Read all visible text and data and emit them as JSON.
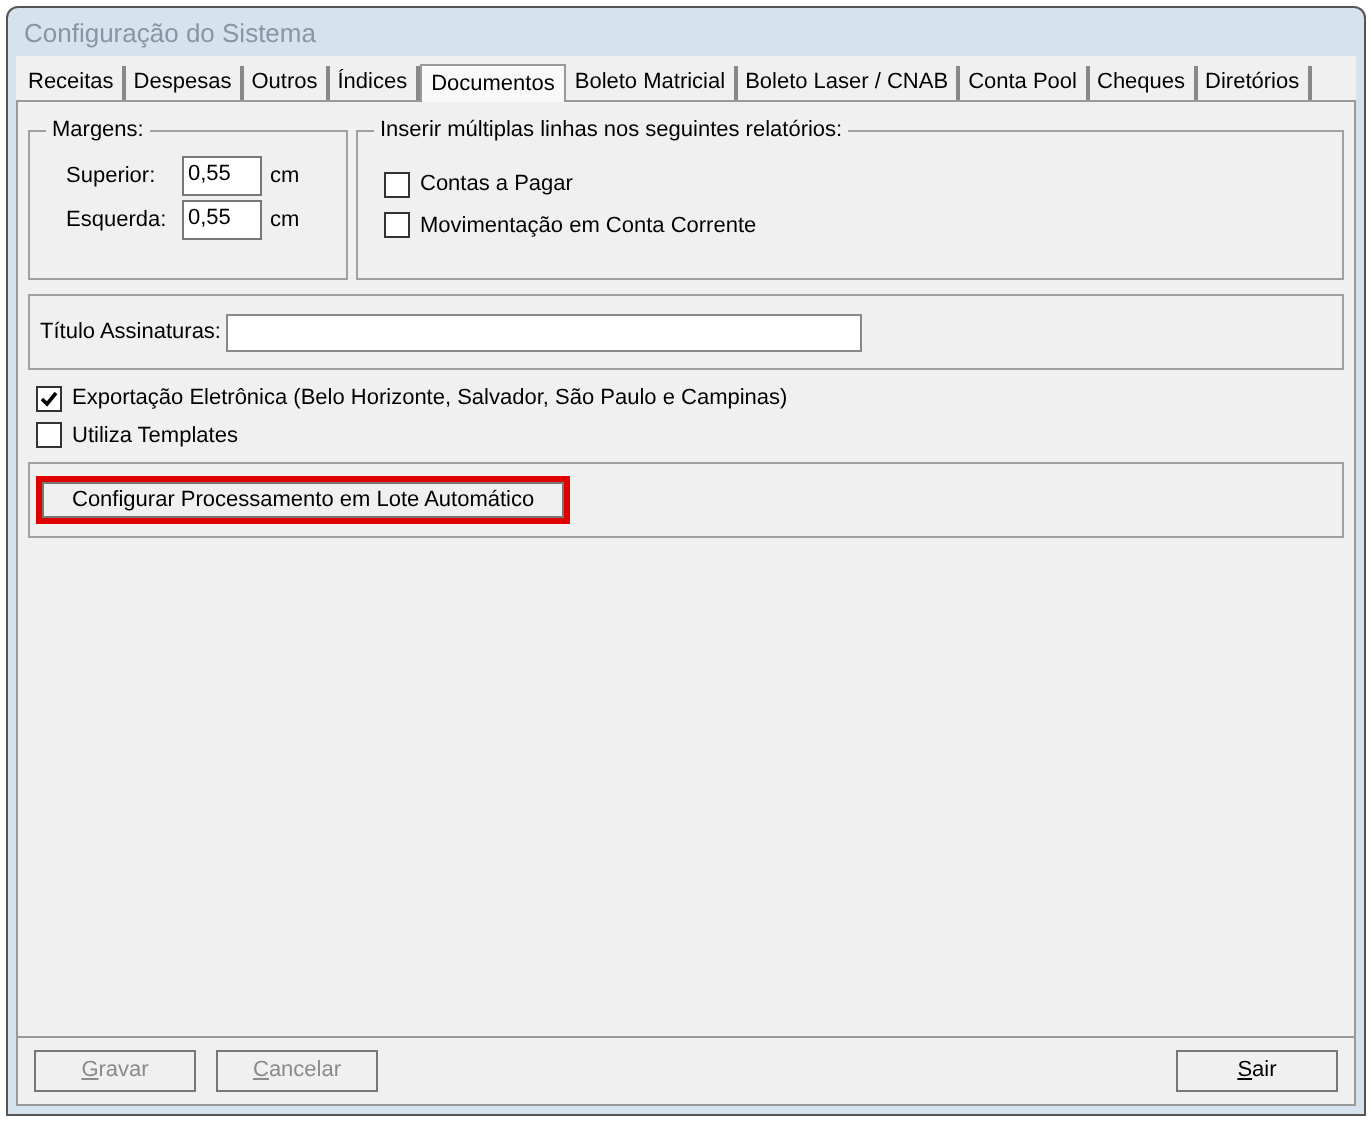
{
  "window": {
    "title": "Configuração do Sistema"
  },
  "tabs": [
    {
      "label": "Receitas",
      "selected": false
    },
    {
      "label": "Despesas",
      "selected": false
    },
    {
      "label": "Outros",
      "selected": false
    },
    {
      "label": "Índices",
      "selected": false
    },
    {
      "label": "Documentos",
      "selected": true
    },
    {
      "label": "Boleto Matricial",
      "selected": false
    },
    {
      "label": "Boleto Laser / CNAB",
      "selected": false
    },
    {
      "label": "Conta Pool",
      "selected": false
    },
    {
      "label": "Cheques",
      "selected": false
    },
    {
      "label": "Diretórios",
      "selected": false
    }
  ],
  "margins": {
    "title": "Margens:",
    "fields": [
      {
        "label": "Superior:",
        "value": "0,55",
        "unit": "cm"
      },
      {
        "label": "Esquerda:",
        "value": "0,55",
        "unit": "cm"
      }
    ]
  },
  "multi_lines": {
    "title": "Inserir múltiplas linhas nos seguintes relatórios:",
    "options": [
      {
        "label": "Contas a Pagar",
        "checked": false
      },
      {
        "label": "Movimentação em Conta Corrente",
        "checked": false
      }
    ]
  },
  "signature_title": {
    "label": "Título Assinaturas:"
  },
  "options": [
    {
      "label": "Exportação Eletrônica (Belo Horizonte, Salvador, São Paulo e Campinas)",
      "checked": true
    },
    {
      "label": "Utiliza Templates",
      "checked": false
    }
  ],
  "batch_button": {
    "label": "Configurar Processamento em Lote Automático",
    "highlighted": true
  },
  "footer_buttons": [
    {
      "label": "Gravar",
      "disabled": true
    },
    {
      "label": "Cancelar",
      "disabled": true
    },
    {
      "label": "Sair",
      "disabled": false
    }
  ]
}
